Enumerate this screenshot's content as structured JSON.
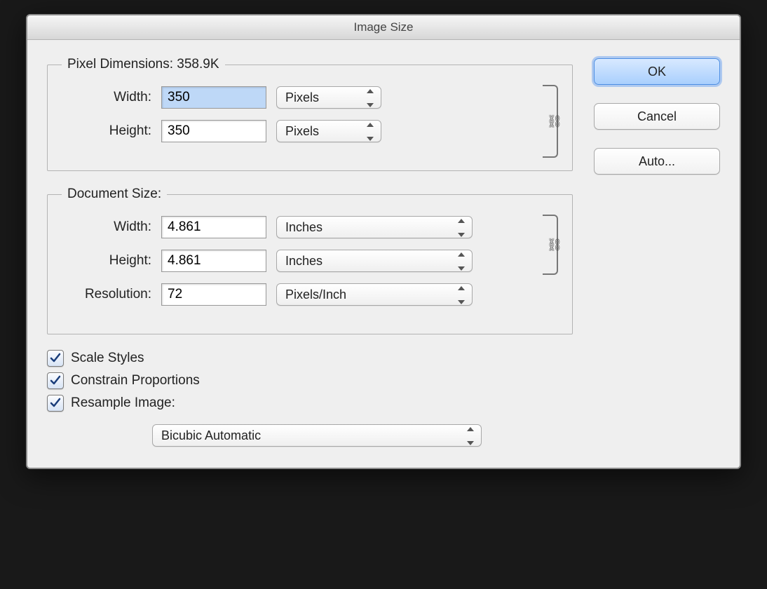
{
  "dialog": {
    "title": "Image Size",
    "pixel_dimensions": {
      "legend_prefix": "Pixel Dimensions:  ",
      "file_size": "358.9K",
      "width_label": "Width:",
      "width_value": "350",
      "width_unit": "Pixels",
      "height_label": "Height:",
      "height_value": "350",
      "height_unit": "Pixels"
    },
    "document_size": {
      "legend": "Document Size:",
      "width_label": "Width:",
      "width_value": "4.861",
      "width_unit": "Inches",
      "height_label": "Height:",
      "height_value": "4.861",
      "height_unit": "Inches",
      "resolution_label": "Resolution:",
      "resolution_value": "72",
      "resolution_unit": "Pixels/Inch"
    },
    "checks": {
      "scale_styles": "Scale Styles",
      "constrain_proportions": "Constrain Proportions",
      "resample_image": "Resample Image:"
    },
    "resample_method": "Bicubic Automatic",
    "buttons": {
      "ok": "OK",
      "cancel": "Cancel",
      "auto": "Auto..."
    },
    "link_glyph": "⛓"
  }
}
